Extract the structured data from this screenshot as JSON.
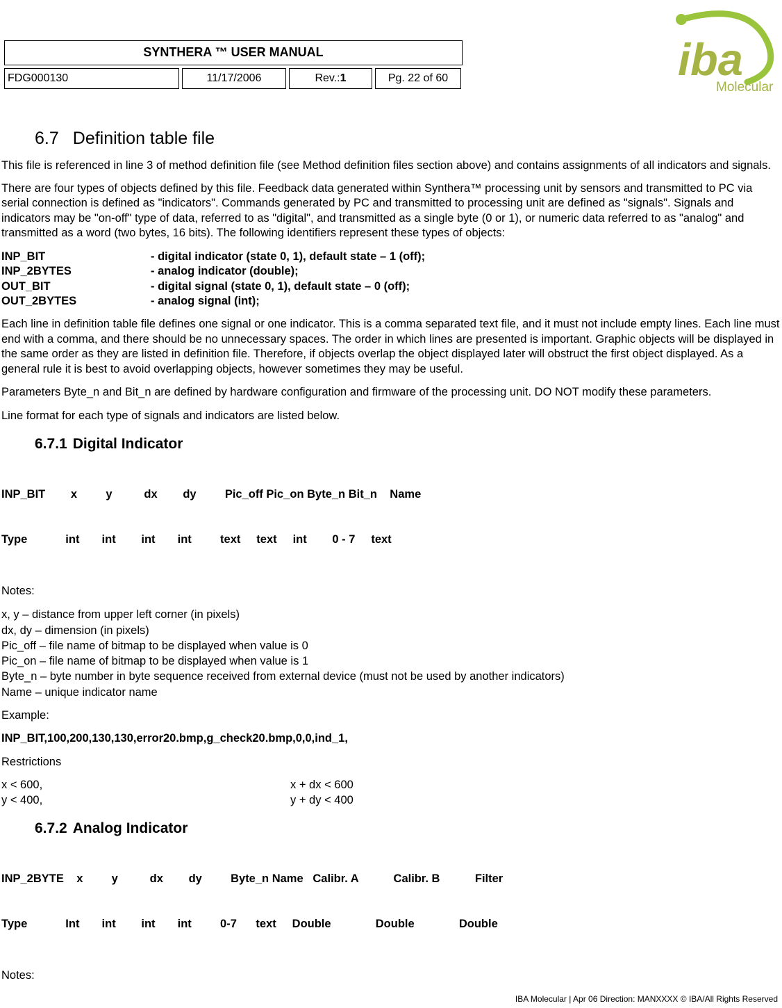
{
  "header": {
    "title": "SYNTHERA ™ USER MANUAL",
    "doc_id": "FDG000130",
    "date": "11/17/2006",
    "rev_label": "Rev.: ",
    "rev_value": "1",
    "page": "Pg. 22 of 60"
  },
  "logo": {
    "top_text": "iba",
    "bottom_text": "Molecular",
    "swirl_color": "#9ac43c",
    "text_color": "#a6b446"
  },
  "section": {
    "num": "6.7",
    "title": "Definition table file",
    "p1": "This file is referenced in line 3 of method definition file (see Method definition files section above) and contains assignments of all indicators and signals.",
    "p2": "There are four types of objects defined by this file.  Feedback data generated within Synthera™ processing unit by sensors and transmitted to PC via serial connection is defined as \"indicators\".  Commands generated by PC and transmitted to processing unit are defined as \"signals\".   Signals and indicators may be \"on-off\" type of data, referred to as \"digital\", and transmitted as a single byte (0 or 1), or numeric data referred to as \"analog\" and transmitted as a word (two bytes, 16 bits).  The following identifiers represent these types of objects:",
    "defs": [
      {
        "k": "INP_BIT",
        "v": "- digital indicator (state 0, 1), default state – 1 (off);"
      },
      {
        "k": "INP_2BYTES",
        "v": "- analog indicator (double);"
      },
      {
        "k": "OUT_BIT",
        "v": "- digital signal (state 0, 1), default state – 0 (off);"
      },
      {
        "k": "OUT_2BYTES",
        "v": "- analog signal (int);"
      }
    ],
    "p3": "Each line in definition table file defines one signal or one indicator.  This is a comma separated text file, and it must not include empty lines.  Each line must end with a comma, and there should be no unnecessary spaces. The order in which lines are presented is important.  Graphic objects will be displayed in the same order as they are listed in definition file.  Therefore, if objects overlap the object displayed later will obstruct the first object displayed.  As a general rule it is best to avoid overlapping objects, however sometimes they may be useful.",
    "p4": "Parameters Byte_n and Bit_n are defined by hardware configuration and firmware of the processing unit.  DO NOT modify these parameters.",
    "p5": "Line format for each type of signals and indicators are listed below."
  },
  "sub1": {
    "num": "6.7.1",
    "title": "Digital Indicator",
    "table_l1": "INP_BIT        x         y          dx        dy         Pic_off Pic_on Byte_n Bit_n    Name",
    "table_l2": "Type            int       int        int       int         text     text     int        0 - 7     text",
    "notes_label": "Notes:",
    "notes": [
      "x, y – distance from upper left corner (in pixels)",
      "dx, dy – dimension (in pixels)",
      "Pic_off – file name of bitmap to be displayed when value is 0",
      "Pic_on – file name of bitmap to be displayed when value is 1",
      "Byte_n – byte number in byte sequence received from external device (must not be used by another indicators)",
      "Name – unique indicator name"
    ],
    "example_label": "Example:",
    "example": "INP_BIT,100,200,130,130,error20.bmp,g_check20.bmp,0,0,ind_1,",
    "restrictions_label": "Restrictions",
    "restrict": [
      {
        "a": "x < 600,",
        "b": "x + dx < 600"
      },
      {
        "a": "y < 400,",
        "b": "y + dy < 400"
      }
    ]
  },
  "sub2": {
    "num": "6.7.2",
    "title": "Analog Indicator",
    "table_l1": "INP_2BYTE    x         y          dx        dy         Byte_n Name   Calibr. A           Calibr. B           Filter",
    "table_l2": "Type            Int       int        int       int         0-7      text     Double              Double              Double",
    "notes_label": "Notes:"
  },
  "footer": "IBA Molecular  |  Apr 06 Direction: MANXXXX © IBA/All Rights Reserved"
}
